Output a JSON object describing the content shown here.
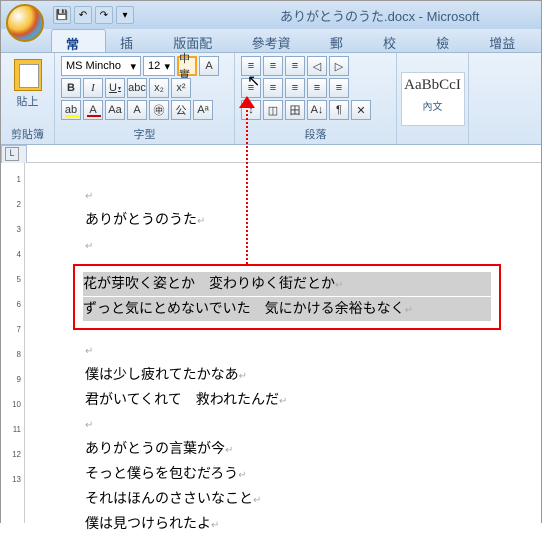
{
  "title": "ありがとうのうた.docx - Microsoft",
  "qat": {
    "save": "💾",
    "undo": "↶",
    "redo": "↷"
  },
  "tabs": [
    "常用",
    "插入",
    "版面配置",
    "參考資料",
    "郵件",
    "校閱",
    "檢視",
    "增益集"
  ],
  "active_tab": 0,
  "clipboard": {
    "paste": "貼上",
    "label": "剪貼簿"
  },
  "font": {
    "name": "MS Mincho",
    "size": "12",
    "grow": "中實",
    "a_box": "A",
    "b": "B",
    "i": "I",
    "u": "U",
    "strike": "abc",
    "sub": "x₂",
    "sup": "x²",
    "hl": "ab",
    "color": "A",
    "case": "Aa",
    "charfit": "A",
    "circled": "㊥",
    "ruby": "公",
    "clear": "Aᵃ",
    "label": "字型"
  },
  "para": {
    "bullets": "≡",
    "numbers": "≡",
    "multilevel": "≡",
    "indent_dec": "◁",
    "indent_inc": "▷",
    "al": "≡",
    "ac": "≡",
    "ar": "≡",
    "aj": "≡",
    "ad": "≡",
    "ls": "↕",
    "shade": "◫",
    "border": "田",
    "sort": "A↓",
    "marks": "¶",
    "asian": "✕",
    "label": "段落"
  },
  "style": {
    "sample": "AaBbCcI",
    "name": "內文"
  },
  "ruler_corner": "L",
  "ruler_v_ticks": [
    "1",
    "2",
    "3",
    "4",
    "5",
    "6",
    "7",
    "8",
    "9",
    "10",
    "11",
    "12",
    "13"
  ],
  "doc": {
    "l1": "ありがとうのうた",
    "s1": "花が芽吹く姿とか　変わりゆく街だとか",
    "s2": "ずっと気にとめないでいた　気にかける余裕もなく",
    "l2": "僕は少し疲れてたかなあ",
    "l3": "君がいてくれて　救われたんだ",
    "l4": "ありがとうの言葉が今",
    "l5": "そっと僕らを包むだろう",
    "l6": "それはほんのささいなこと",
    "l7": "僕は見つけられたよ"
  }
}
